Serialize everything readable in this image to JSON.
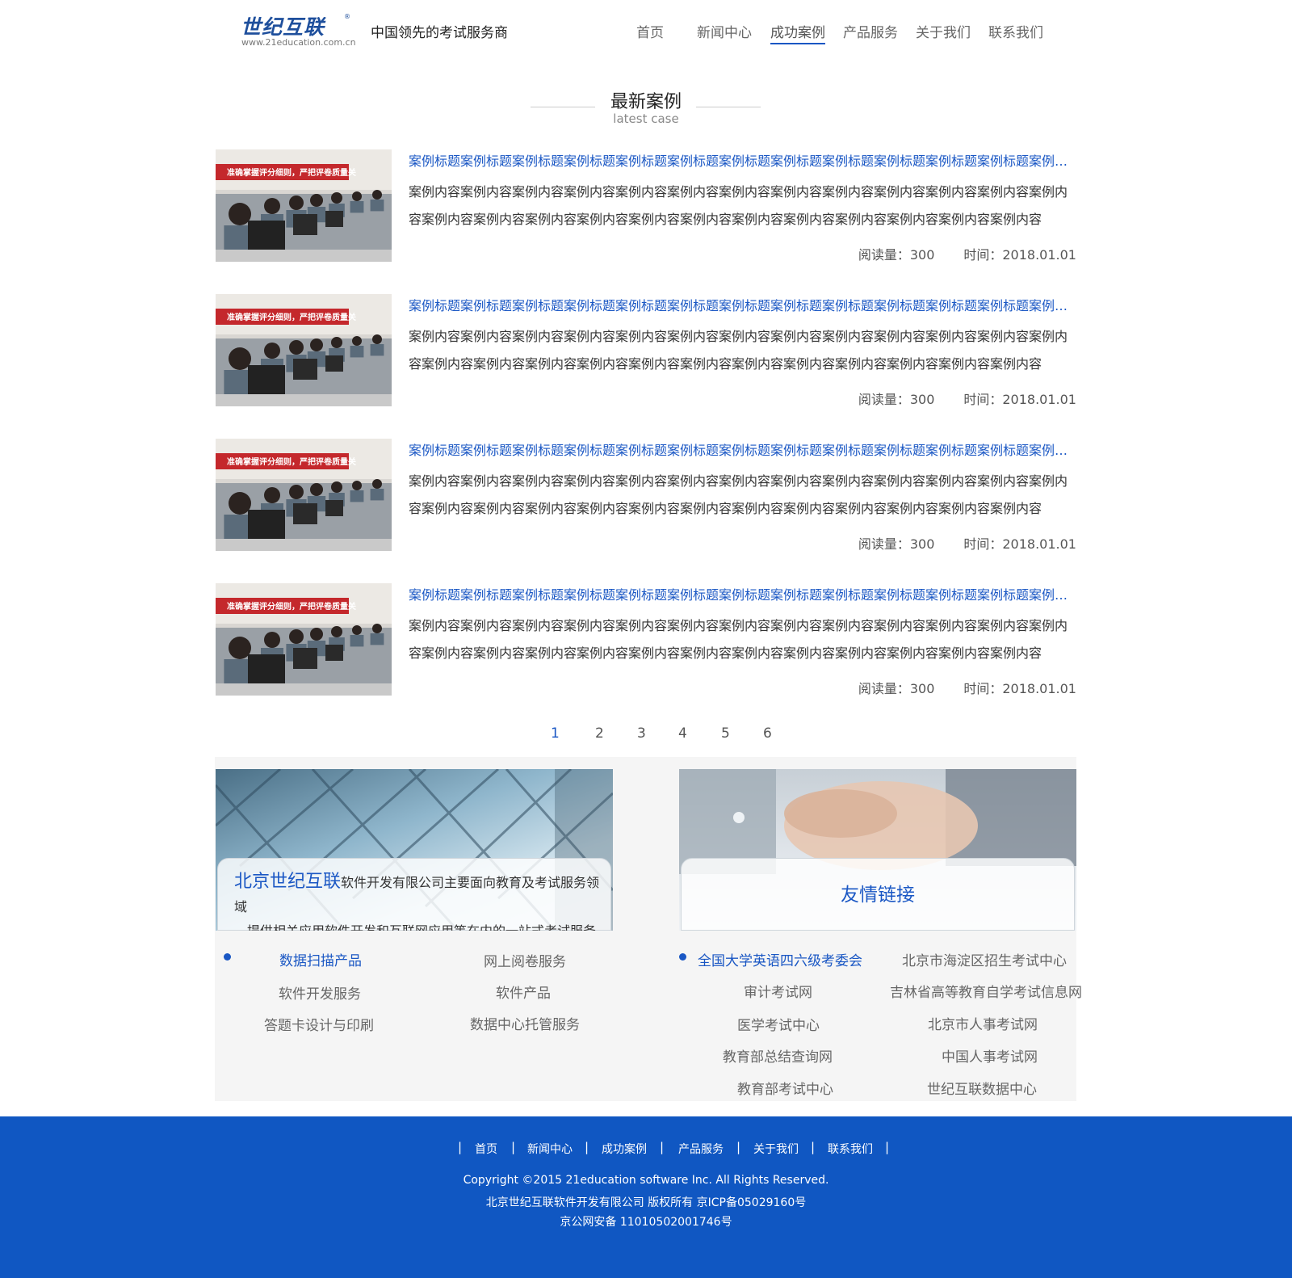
{
  "header": {
    "logo_text": "世纪互联",
    "logo_reg": "®",
    "logo_url": "www.21education.com.cn",
    "slogan": "中国领先的考试服务商",
    "nav": [
      "首页",
      "新闻中心",
      "成功案例",
      "产品服务",
      "关于我们",
      "联系我们"
    ],
    "active_nav": "成功案例"
  },
  "section": {
    "title_cn": "最新案例",
    "title_en": "latest case"
  },
  "cases": [
    {
      "title": "案例标题案例标题案例标题案例标题案例标题案例标题案例标题案例标题案例标题案例标题案例标题案例标题案例标题",
      "body": "案例内容案例内容案例内容案例内容案例内容案例内容案例内容案例内容案例内容案例内容案例内容案例内容案例内容案例内容案例内容案例内容案例内容案例内容案例内容案例内容案例内容案例内容案例内容案例内容案例内容",
      "views": "阅读量：300",
      "date": "时间：2018.01.01"
    },
    {
      "title": "案例标题案例标题案例标题案例标题案例标题案例标题案例标题案例标题案例标题案例标题案例标题案例标题案例标题",
      "body": "案例内容案例内容案例内容案例内容案例内容案例内容案例内容案例内容案例内容案例内容案例内容案例内容案例内容案例内容案例内容案例内容案例内容案例内容案例内容案例内容案例内容案例内容案例内容案例内容案例内容",
      "views": "阅读量：300",
      "date": "时间：2018.01.01"
    },
    {
      "title": "案例标题案例标题案例标题案例标题案例标题案例标题案例标题案例标题案例标题案例标题案例标题案例标题案例标题",
      "body": "案例内容案例内容案例内容案例内容案例内容案例内容案例内容案例内容案例内容案例内容案例内容案例内容案例内容案例内容案例内容案例内容案例内容案例内容案例内容案例内容案例内容案例内容案例内容案例内容案例内容",
      "views": "阅读量：300",
      "date": "时间：2018.01.01"
    },
    {
      "title": "案例标题案例标题案例标题案例标题案例标题案例标题案例标题案例标题案例标题案例标题案例标题案例标题案例标题",
      "body": "案例内容案例内容案例内容案例内容案例内容案例内容案例内容案例内容案例内容案例内容案例内容案例内容案例内容案例内容案例内容案例内容案例内容案例内容案例内容案例内容案例内容案例内容案例内容案例内容案例内容",
      "views": "阅读量：300",
      "date": "时间：2018.01.01"
    }
  ],
  "case_image": {
    "banner_text": "准确掌握评分细则，严把评卷质量关"
  },
  "pagination": {
    "pages": [
      "1",
      "2",
      "3",
      "4",
      "5",
      "6"
    ],
    "current": "1"
  },
  "about": {
    "brand": "北京世纪互联",
    "line1": "软件开发有限公司主要面向教育及考试服务领域",
    "line2": "，提供相关应用软件开发和互联网应用等在内的一站式考试服务",
    "links": [
      "数据扫描产品",
      "网上阅卷服务",
      "软件开发服务",
      "软件产品",
      "答题卡设计与印刷",
      "数据中心托管服务"
    ]
  },
  "friends": {
    "title": "友情链接",
    "links": [
      "全国大学英语四六级考委会",
      "北京市海淀区招生考试中心",
      "审计考试网",
      "吉林省高等教育自学考试信息网",
      "医学考试中心",
      "北京市人事考试网",
      "教育部总结查询网",
      "中国人事考试网",
      "教育部考试中心",
      "世纪互联数据中心"
    ]
  },
  "footer": {
    "nav": [
      "首页",
      "新闻中心",
      "成功案例",
      "产品服务",
      "关于我们",
      "联系我们"
    ],
    "separator": "|",
    "copyright": "Copyright ©2015 21education software Inc. All Rights Reserved.",
    "company": "北京世纪互联软件开发有限公司 版权所有 京ICP备05029160号",
    "police": "京公网安备 11010502001746号"
  },
  "colors": {
    "accent": "#1a57c4",
    "footer_bg": "#1057c2",
    "panel_bg": "#f5f5f5"
  }
}
